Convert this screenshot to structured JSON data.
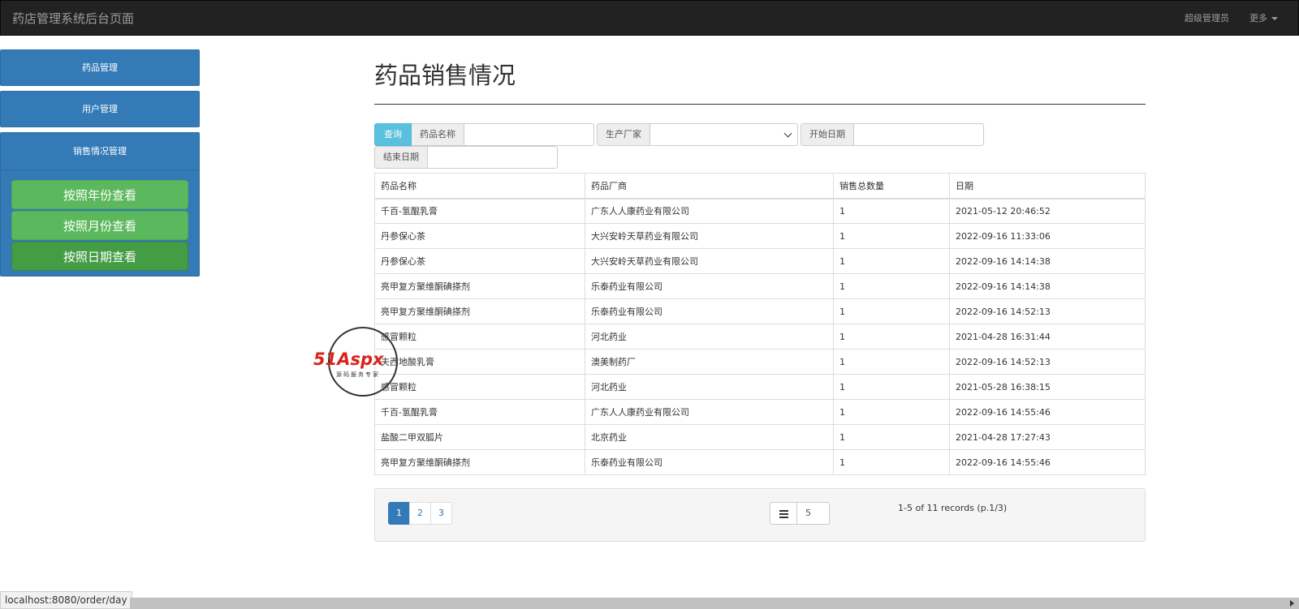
{
  "navbar": {
    "brand": "药店管理系统后台页面",
    "admin": "超级管理员",
    "more": "更多"
  },
  "sidebar": {
    "items": [
      {
        "label": "药品管理"
      },
      {
        "label": "用户管理"
      }
    ],
    "group": {
      "label": "销售情况管理",
      "sub_items": [
        {
          "label": "按照年份查看"
        },
        {
          "label": "按照月份查看"
        },
        {
          "label": "按照日期查看"
        }
      ]
    }
  },
  "main": {
    "title": "药品销售情况",
    "filter": {
      "query_button": "查询",
      "drug_name_label": "药品名称",
      "drug_name_value": "",
      "manufacturer_label": "生产厂家",
      "manufacturer_value": "",
      "start_date_label": "开始日期",
      "start_date_value": "",
      "end_date_label": "结束日期",
      "end_date_value": ""
    },
    "table": {
      "headers": [
        "药品名称",
        "药品厂商",
        "销售总数量",
        "日期"
      ],
      "rows": [
        [
          "千百-氢醌乳膏",
          "广东人人康药业有限公司",
          "1",
          "2021-05-12 20:46:52"
        ],
        [
          "丹参保心茶",
          "大兴安岭天草药业有限公司",
          "1",
          "2022-09-16 11:33:06"
        ],
        [
          "丹参保心茶",
          "大兴安岭天草药业有限公司",
          "1",
          "2022-09-16 14:14:38"
        ],
        [
          "亮甲复方聚维酮碘搽剂",
          "乐泰药业有限公司",
          "1",
          "2022-09-16 14:14:38"
        ],
        [
          "亮甲复方聚维酮碘搽剂",
          "乐泰药业有限公司",
          "1",
          "2022-09-16 14:52:13"
        ],
        [
          "感冒颗粒",
          "河北药业",
          "1",
          "2021-04-28 16:31:44"
        ],
        [
          "夫西地酸乳膏",
          "澳美制药厂",
          "1",
          "2022-09-16 14:52:13"
        ],
        [
          "感冒颗粒",
          "河北药业",
          "1",
          "2021-05-28 16:38:15"
        ],
        [
          "千百-氢醌乳膏",
          "广东人人康药业有限公司",
          "1",
          "2022-09-16 14:55:46"
        ],
        [
          "盐酸二甲双胍片",
          "北京药业",
          "1",
          "2021-04-28 17:27:43"
        ],
        [
          "亮甲复方聚维酮碘搽剂",
          "乐泰药业有限公司",
          "1",
          "2022-09-16 14:55:46"
        ]
      ]
    },
    "pagination": {
      "pages": [
        "1",
        "2",
        "3"
      ],
      "active_page": "1",
      "page_size": "5",
      "records_text": "1-5 of 11 records (p.1/3)",
      "list_icon": "list-icon"
    }
  },
  "watermark": {
    "logo_red": "51",
    "logo_dark": "Aspx",
    "subtitle": "源码服务专家"
  },
  "statusbar": {
    "url": "localhost:8080/order/day"
  },
  "colors": {
    "primary": "#337ab7",
    "success": "#5cb85c",
    "info": "#5bc0de",
    "navbar": "#222222"
  }
}
